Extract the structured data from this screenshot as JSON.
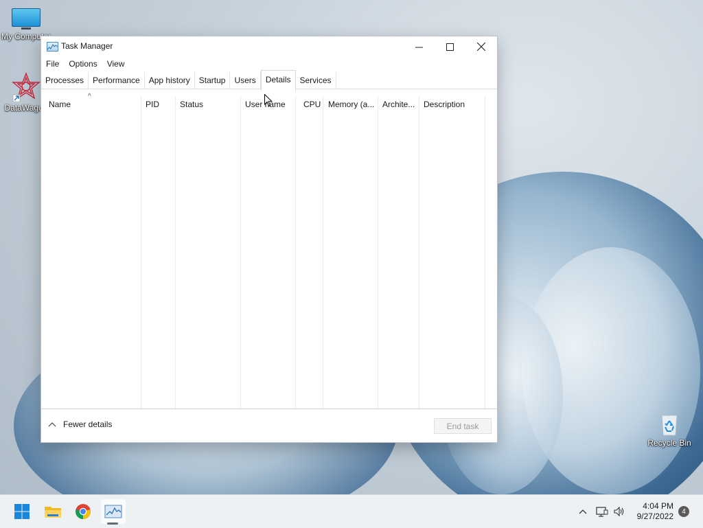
{
  "desktop": {
    "icons": [
      {
        "label": "My Computer",
        "icon": "monitor-icon"
      },
      {
        "label": "DataWagon",
        "icon": "datawagon-icon"
      },
      {
        "label": "Recycle Bin",
        "icon": "recycle-bin-icon"
      }
    ]
  },
  "window": {
    "title": "Task Manager",
    "menu": [
      "File",
      "Options",
      "View"
    ],
    "tabs": [
      {
        "label": "Processes",
        "active": false
      },
      {
        "label": "Performance",
        "active": false
      },
      {
        "label": "App history",
        "active": false
      },
      {
        "label": "Startup",
        "active": false
      },
      {
        "label": "Users",
        "active": false
      },
      {
        "label": "Details",
        "active": true
      },
      {
        "label": "Services",
        "active": false
      }
    ],
    "columns": [
      "Name",
      "PID",
      "Status",
      "User name",
      "CPU",
      "Memory (a...",
      "Archite...",
      "Description"
    ],
    "footer": {
      "fewer_details": "Fewer details",
      "end_task": "End task"
    }
  },
  "taskbar": {
    "apps": [
      "start-icon",
      "file-explorer-icon",
      "chrome-icon",
      "task-manager-icon"
    ],
    "time": "4:04 PM",
    "date": "9/27/2022",
    "notifications": "4"
  },
  "colors": {
    "accent": "#0078d4",
    "taskbar_bg": "#eef1f4"
  }
}
